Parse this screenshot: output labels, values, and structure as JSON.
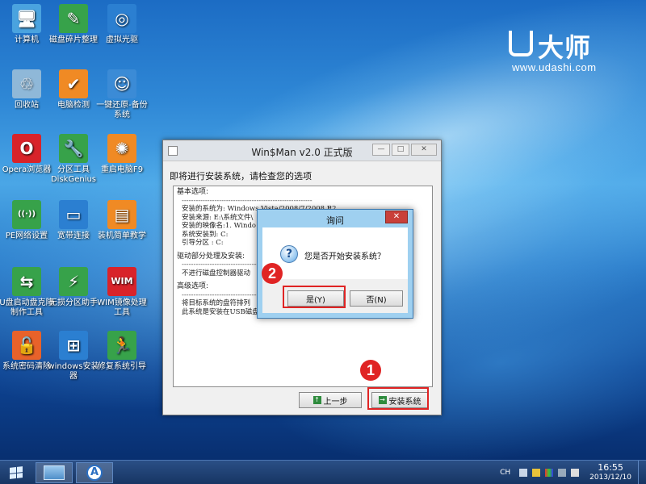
{
  "desktop_icons": [
    {
      "label": "计算机",
      "icon": "computer-icon",
      "color": "#4aa3df"
    },
    {
      "label": "磁盘碎片整理",
      "icon": "broom-icon",
      "color": "#37a24a"
    },
    {
      "label": "虚拟光驱",
      "icon": "disc-icon",
      "color": "#2b7fd1"
    },
    {
      "label": "回收站",
      "icon": "recycle-bin-icon",
      "color": "#8fb8d8"
    },
    {
      "label": "电脑检测",
      "icon": "shield-check-icon",
      "color": "#f08a24"
    },
    {
      "label": "一键还原-备份系统",
      "icon": "ghost-icon",
      "color": "#3b8bd6"
    },
    {
      "label": "Opera浏览器",
      "icon": "opera-icon",
      "color": "#d8232a"
    },
    {
      "label": "分区工具DiskGenius",
      "icon": "wrench-icon",
      "color": "#37a24a"
    },
    {
      "label": "重启电脑F9",
      "icon": "restart-icon",
      "color": "#f08a24"
    },
    {
      "label": "PE网络设置",
      "icon": "wifi-icon",
      "color": "#37a24a"
    },
    {
      "label": "宽带连接",
      "icon": "network-icon",
      "color": "#2b7fd1"
    },
    {
      "label": "装机简单教学",
      "icon": "book-icon",
      "color": "#f08a24"
    },
    {
      "label": "U盘启动盘克隆制作工具",
      "icon": "usb-icon",
      "color": "#37a24a"
    },
    {
      "label": "无损分区助手",
      "icon": "partition-icon",
      "color": "#37a24a"
    },
    {
      "label": "WIM镜像处理工具",
      "icon": "wim-icon",
      "color": "#d8232a"
    },
    {
      "label": "系统密码清除",
      "icon": "unlock-icon",
      "color": "#e8622a"
    },
    {
      "label": "windows安装器",
      "icon": "windows-icon",
      "color": "#2b7fd1"
    },
    {
      "label": "修复系统引导",
      "icon": "runner-icon",
      "color": "#37a24a"
    }
  ],
  "logo": {
    "brand": "大师",
    "url": "www.udashi.com"
  },
  "window": {
    "title": "Win$Man v2.0 正式版",
    "prompt": "即将进行安装系统，请检查您的选项",
    "section_basic": "基本选项:",
    "lines_basic": [
      "安装的系统为: Windows Vista/2008/7/2008 R2",
      "安装来源: E:\\系统文件\\",
      "安装的映像名:1. Windo",
      "系统安装到: C:",
      "引导分区   : C:"
    ],
    "section_driver": "驱动部分处理及安装:",
    "line_driver": "不进行磁盘控制器驱动",
    "section_adv": "高级选项:",
    "lines_adv": [
      "将目标系统的盘符排列",
      "此系统是安装在USB磁盘"
    ],
    "back_button": "上一步",
    "install_button": "安装系统"
  },
  "dialog": {
    "title": "询问",
    "message": "您是否开始安装系统？",
    "yes_button": "是(Y)",
    "no_button": "否(N)"
  },
  "markers": {
    "step1": "1",
    "step2": "2"
  },
  "taskbar": {
    "lang": "CH",
    "time": "16:55",
    "date": "2013/12/10"
  }
}
